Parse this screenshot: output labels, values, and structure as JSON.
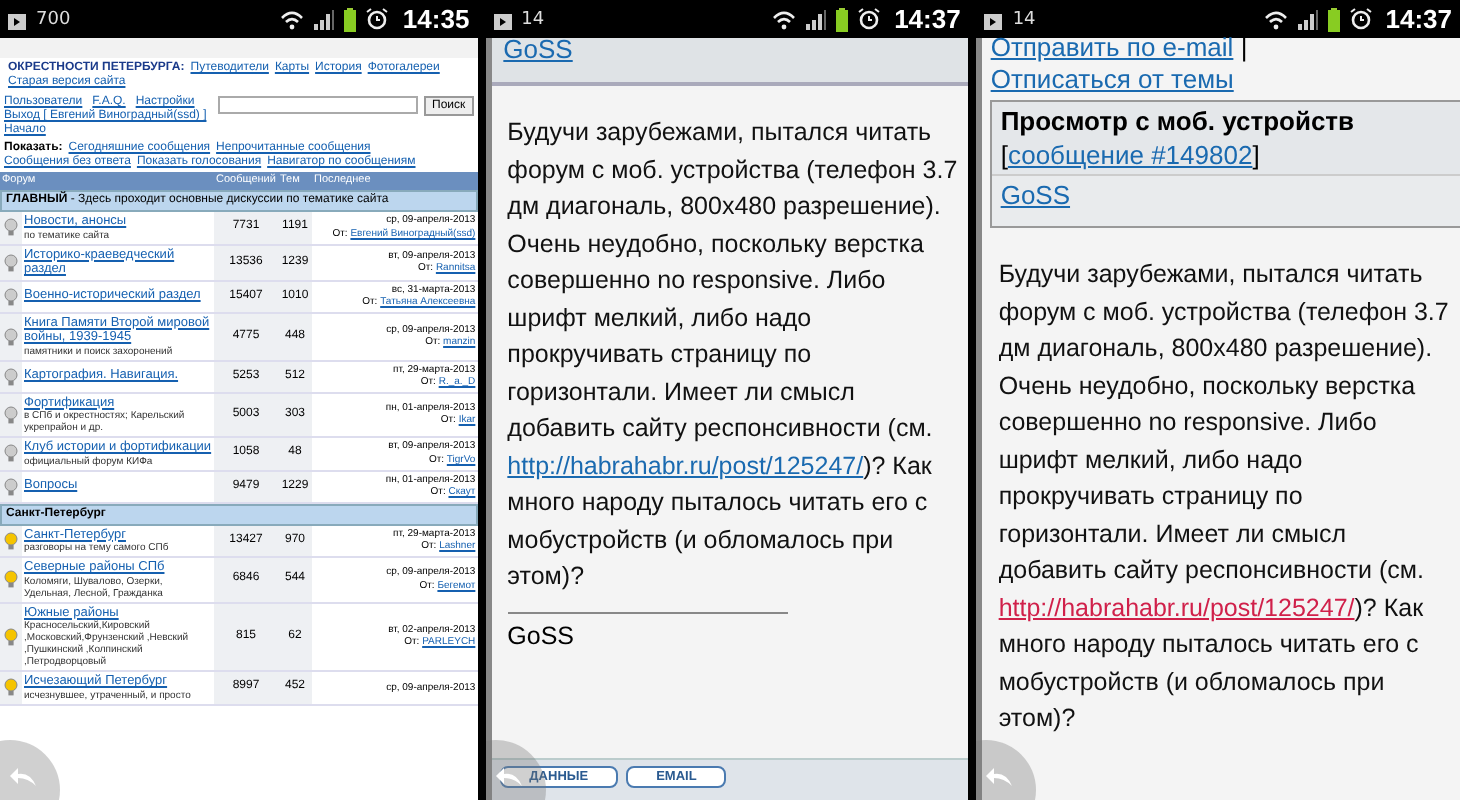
{
  "phones": [
    {
      "kind": "forum",
      "status_bar": {
        "notification": "700",
        "time": "14:35"
      },
      "forum": {
        "logo": "ОКРЕСТНОСТИ ПЕТЕРБУРГА:",
        "nav": [
          "Путеводители",
          "Карты",
          "История",
          "Фотогалереи",
          "Старая версия сайта"
        ],
        "user_links": [
          "Пользователи",
          "F.A.Q.",
          "Настройки",
          "Выход [ Евгений Виноградный(ssd) ]",
          "Начало"
        ],
        "search_button": "Поиск",
        "show_label": "Показать:",
        "show_links": [
          "Сегодняшние сообщения",
          "Непрочитанные сообщения",
          "Сообщения без ответа",
          "Показать голосования",
          "Навигатор по сообщениям"
        ],
        "columns": [
          "Форум",
          "Сообщений",
          "Тем",
          "Последнее"
        ],
        "sections": [
          {
            "title": "ГЛАВНЫЙ",
            "description": " - Здесь проходит основные дискуссии по тематике сайта",
            "forums": [
              {
                "name": "Новости, анонсы",
                "description": "по тематике сайта",
                "posts": "7731",
                "topics": "1191",
                "date": "ср, 09-апреля-2013",
                "from": "От:",
                "author": "Евгений Виноградный(ssd)",
                "unread": false
              },
              {
                "name": "Историко-краеведческий раздел",
                "posts": "13536",
                "topics": "1239",
                "date": "вт, 09-апреля-2013",
                "from": "От:",
                "author": "Rannitsa",
                "unread": false
              },
              {
                "name": "Военно-исторический раздел",
                "posts": "15407",
                "topics": "1010",
                "date": "вс, 31-марта-2013",
                "from": "От:",
                "author": "Татьяна Алексеевна",
                "unread": false
              },
              {
                "name": "Книга Памяти Второй мировой войны, 1939-1945",
                "description": "памятники и поиск захоронений",
                "posts": "4775",
                "topics": "448",
                "date": "ср, 09-апреля-2013",
                "from": "От:",
                "author": "manzin",
                "unread": false
              },
              {
                "name": "Картография. Навигация.",
                "posts": "5253",
                "topics": "512",
                "date": "пт, 29-марта-2013",
                "from": "От:",
                "author": "R._a._D",
                "unread": false
              },
              {
                "name": "Фортификация",
                "description": "в СПб и окрестностях; Карельский укрепрайон и др.",
                "posts": "5003",
                "topics": "303",
                "date": "пн, 01-апреля-2013",
                "from": "От:",
                "author": "Ikar",
                "unread": false
              },
              {
                "name": "Клуб истории и фортификации",
                "description": "официальный форум КИФа",
                "posts": "1058",
                "topics": "48",
                "date": "вт, 09-апреля-2013",
                "from": "От:",
                "author": "TigrVo",
                "unread": false
              },
              {
                "name": "Вопросы",
                "posts": "9479",
                "topics": "1229",
                "date": "пн, 01-апреля-2013",
                "from": "От:",
                "author": "Скаут",
                "unread": false
              }
            ]
          },
          {
            "title": "Санкт-Петербург",
            "forums": [
              {
                "name": "Санкт-Петербург",
                "description": "разговоры на тему самого СПб",
                "posts": "13427",
                "topics": "970",
                "date": "пт, 29-марта-2013",
                "from": "От:",
                "author": "Lashner",
                "unread": true
              },
              {
                "name": "Северные районы СПб",
                "description": "Коломяги, Шувалово, Озерки, Удельная, Лесной, Гражданка",
                "posts": "6846",
                "topics": "544",
                "date": "ср, 09-апреля-2013",
                "from": "От:",
                "author": "Бегемот",
                "unread": true
              },
              {
                "name": "Южные районы",
                "description": "Красносельский,Кировский ,Московский,Фрунзенский ,Невский ,Пушкинский ,Колпинский ,Петродворцовый",
                "posts": "815",
                "topics": "62",
                "date": "вт, 02-апреля-2013",
                "from": "От:",
                "author": "PARLEYCH",
                "unread": true
              },
              {
                "name": "Исчезающий Петербург",
                "description": "исчезнувшее, утраченный, и просто",
                "posts": "8997",
                "topics": "452",
                "date": "ср, 09-апреля-2013",
                "unread": true
              }
            ]
          }
        ]
      }
    },
    {
      "kind": "post",
      "status_bar": {
        "notification": "14",
        "time": "14:37"
      },
      "top_author": "GoSS",
      "body": {
        "before": "Будучи зарубежами, пытался читать форум с моб. устройства (телефон 3.7 дм диагональ, 800x480 разрешение). Очень неудобно, поскольку верстка совершенно no responsive. Либо шрифт мелкий, либо надо прокручивать страницу по горизонтали. Имеет ли смысл добавить сайту респонсивности (см. ",
        "link": "http://habrahabr.ru/post/125247/",
        "after": ")? Как много народу пыталось читать его с мобустройств (и обломалось при этом)?",
        "link_visited": false
      },
      "signature": "GoSS",
      "buttons": [
        "ДАННЫЕ",
        "EMAIL"
      ]
    },
    {
      "kind": "post",
      "status_bar": {
        "notification": "14",
        "time": "14:37"
      },
      "links": [
        "Отправить по e-mail",
        "Отписаться от темы"
      ],
      "link_separator": "|",
      "title": "Просмотр с моб. устройств",
      "ref": {
        "open": "[",
        "link": "сообщение #149802",
        "close": "]"
      },
      "author": "GoSS",
      "body": {
        "before": "Будучи зарубежами, пытался читать форум с моб. устройства (телефон 3.7 дм диагональ, 800x480 разрешение). Очень неудобно, поскольку верстка совершенно no responsive. Либо шрифт мелкий, либо надо прокручивать страницу по горизонтали. Имеет ли смысл добавить сайту респонсивности (см. ",
        "link": "http://habrahabr.ru/post/125247/",
        "after": ")? Как много народу пыталось читать его с мобустройств (и обломалось при этом)?",
        "link_visited": true
      }
    }
  ]
}
